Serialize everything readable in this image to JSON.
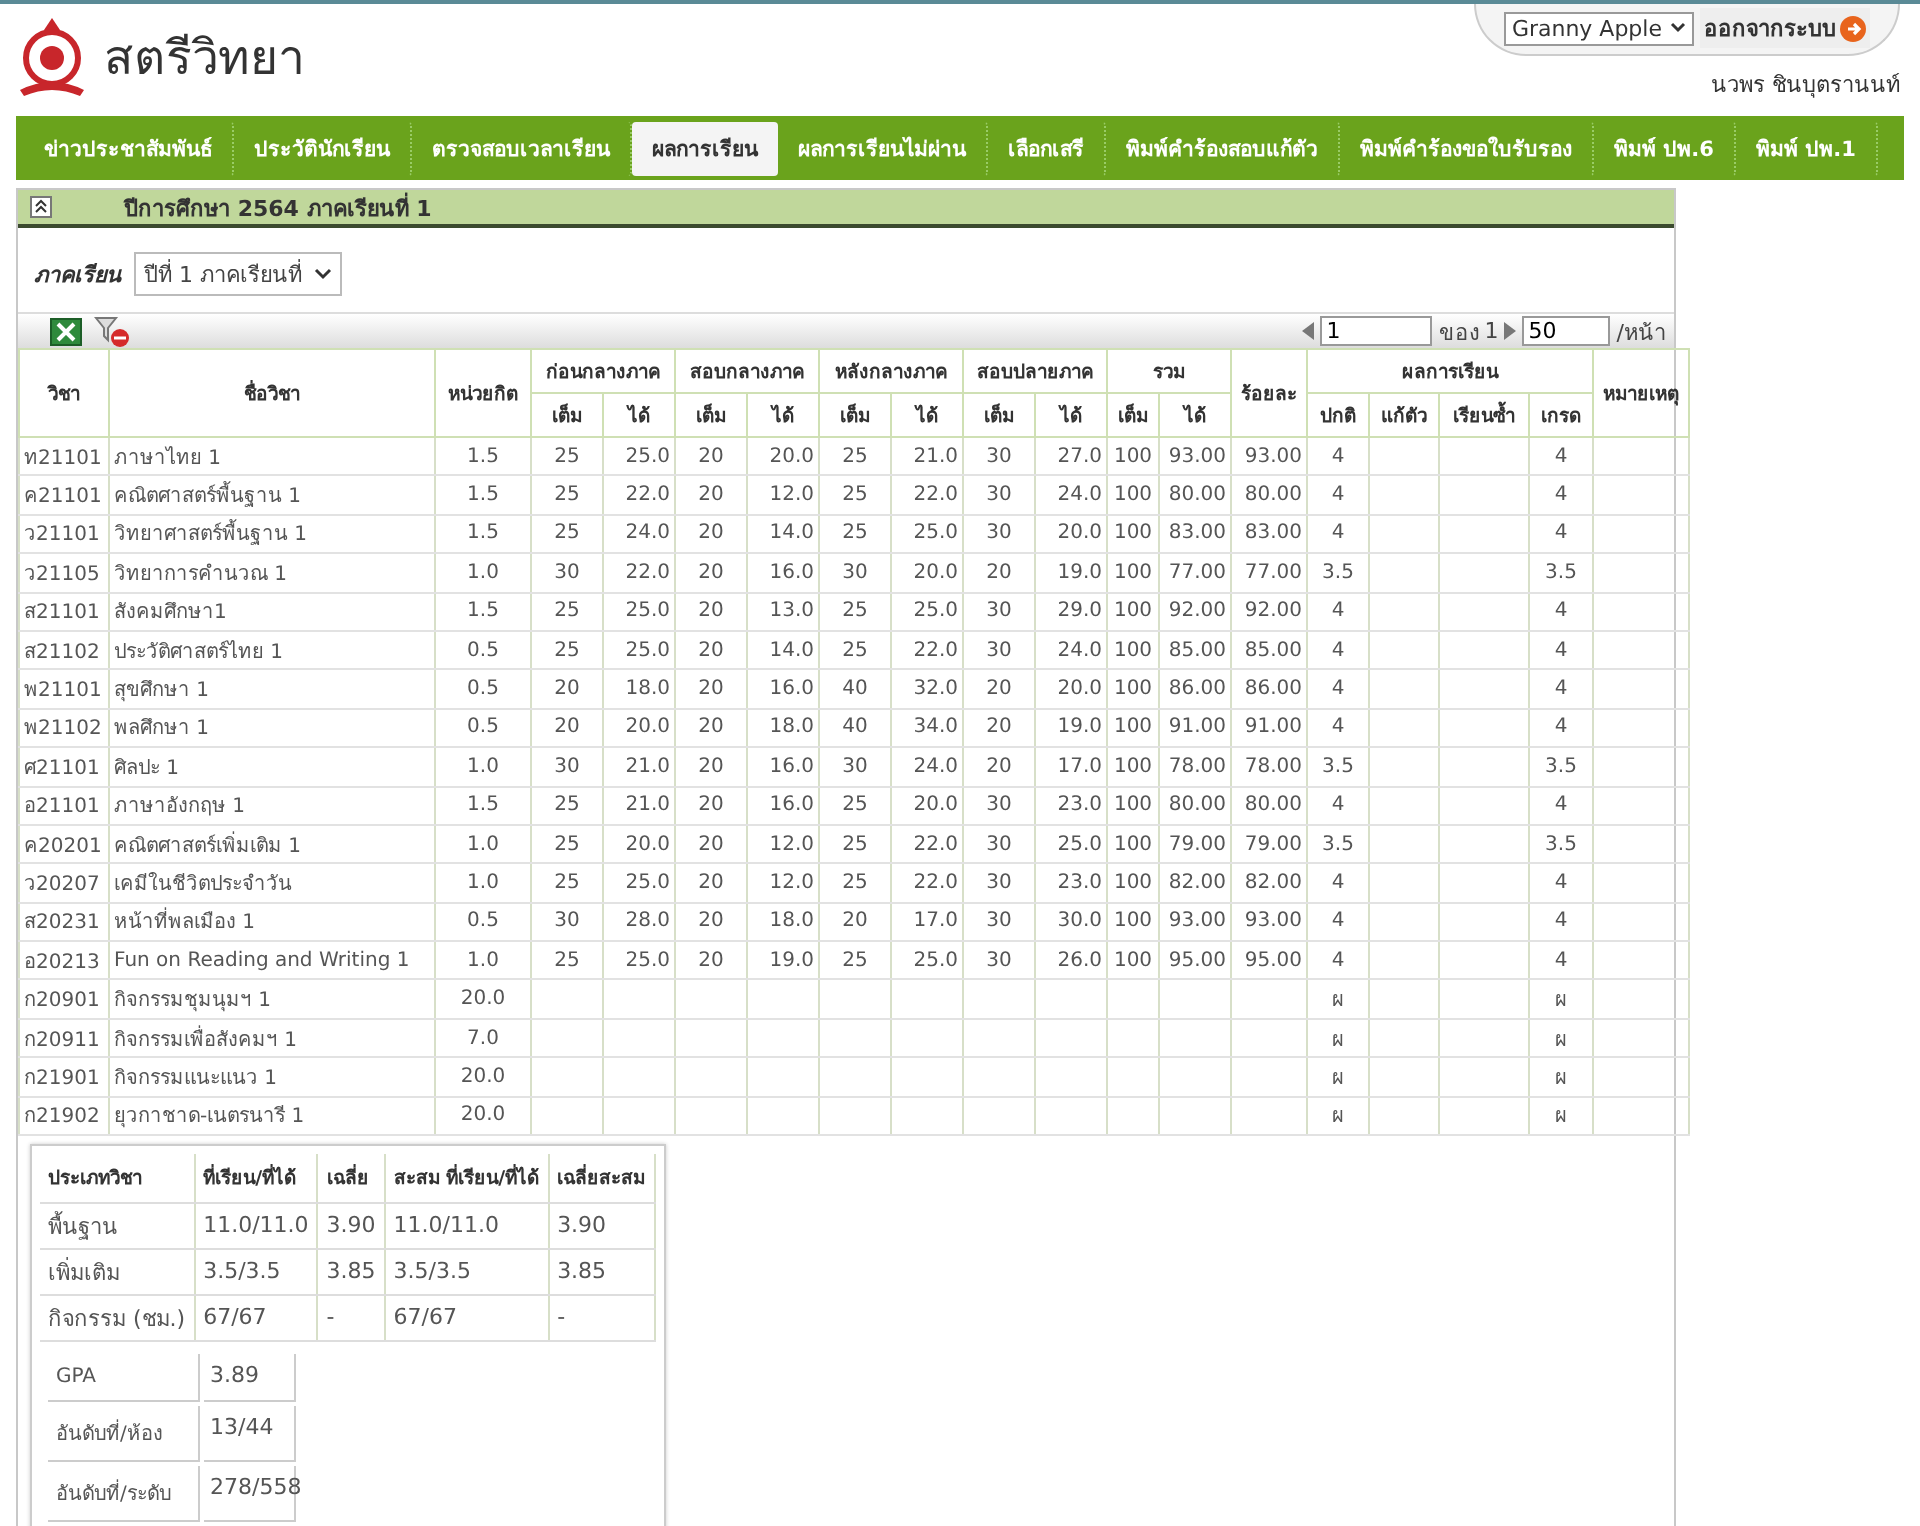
{
  "header": {
    "logo_text": "สตรีวิทยา",
    "theme_select": "Granny Apple",
    "logout": "ออกจากระบบ",
    "user": "นวพร  ชินบุตรานนท์"
  },
  "nav": [
    {
      "label": "ข่าวประชาสัมพันธ์",
      "selected": false
    },
    {
      "label": "ประวัตินักเรียน",
      "selected": false
    },
    {
      "label": "ตรวจสอบเวลาเรียน",
      "selected": false
    },
    {
      "label": "ผลการเรียน",
      "selected": true
    },
    {
      "label": "ผลการเรียนไม่ผ่าน",
      "selected": false
    },
    {
      "label": "เลือกเสรี",
      "selected": false
    },
    {
      "label": "พิมพ์คำร้องสอบแก้ตัว",
      "selected": false
    },
    {
      "label": "พิมพ์คำร้องขอใบรับรอง",
      "selected": false
    },
    {
      "label": "พิมพ์ ปพ.6",
      "selected": false
    },
    {
      "label": "พิมพ์ ปพ.1",
      "selected": false
    }
  ],
  "panel": {
    "title": "ปีการศึกษา  2564  ภาคเรียนที่  1",
    "expanded": true
  },
  "filter": {
    "label": "ภาคเรียน",
    "value": "ปีที่  1  ภาคเรียนที่"
  },
  "pager": {
    "page": "1",
    "of_label": "ของ",
    "total": "1",
    "per_page": "50",
    "per_page_label": "/หน้า"
  },
  "table": {
    "columns": [
      {
        "kind": "single",
        "label": "วิชา"
      },
      {
        "kind": "single",
        "label": "ชื่อวิชา"
      },
      {
        "kind": "single",
        "label": "หน่วยกิต"
      },
      {
        "kind": "group",
        "label": "ก่อนกลางภาค",
        "sub": [
          "เต็ม",
          "ได้"
        ]
      },
      {
        "kind": "group",
        "label": "สอบกลางภาค",
        "sub": [
          "เต็ม",
          "ได้"
        ]
      },
      {
        "kind": "group",
        "label": "หลังกลางภาค",
        "sub": [
          "เต็ม",
          "ได้"
        ]
      },
      {
        "kind": "group",
        "label": "สอบปลายภาค",
        "sub": [
          "เต็ม",
          "ได้"
        ]
      },
      {
        "kind": "group",
        "label": "รวม",
        "sub": [
          "เต็ม",
          "ได้"
        ]
      },
      {
        "kind": "single",
        "label": "ร้อยละ"
      },
      {
        "kind": "group",
        "label": "ผลการเรียน",
        "sub": [
          "ปกติ",
          "แก้ตัว",
          "เรียนซ้ำ",
          "เกรด"
        ]
      },
      {
        "kind": "single",
        "label": "หมายเหตุ"
      }
    ],
    "rows": [
      {
        "code": "ท21101",
        "name": "ภาษาไทย  1",
        "credit": "1.5",
        "scores": [
          "25",
          "25.0",
          "20",
          "20.0",
          "25",
          "21.0",
          "30",
          "27.0",
          "100",
          "93.00"
        ],
        "percent": "93.00",
        "normal": "4",
        "grade": "4"
      },
      {
        "code": "ค21101",
        "name": "คณิตศาสตร์พื้นฐาน  1",
        "credit": "1.5",
        "scores": [
          "25",
          "22.0",
          "20",
          "12.0",
          "25",
          "22.0",
          "30",
          "24.0",
          "100",
          "80.00"
        ],
        "percent": "80.00",
        "normal": "4",
        "grade": "4"
      },
      {
        "code": "ว21101",
        "name": "วิทยาศาสตร์พื้นฐาน  1",
        "credit": "1.5",
        "scores": [
          "25",
          "24.0",
          "20",
          "14.0",
          "25",
          "25.0",
          "30",
          "20.0",
          "100",
          "83.00"
        ],
        "percent": "83.00",
        "normal": "4",
        "grade": "4"
      },
      {
        "code": "ว21105",
        "name": "วิทยาการคำนวณ  1",
        "credit": "1.0",
        "scores": [
          "30",
          "22.0",
          "20",
          "16.0",
          "30",
          "20.0",
          "20",
          "19.0",
          "100",
          "77.00"
        ],
        "percent": "77.00",
        "normal": "3.5",
        "grade": "3.5"
      },
      {
        "code": "ส21101",
        "name": "สังคมศึกษา1",
        "credit": "1.5",
        "scores": [
          "25",
          "25.0",
          "20",
          "13.0",
          "25",
          "25.0",
          "30",
          "29.0",
          "100",
          "92.00"
        ],
        "percent": "92.00",
        "normal": "4",
        "grade": "4"
      },
      {
        "code": "ส21102",
        "name": "ประวัติศาสตร์ไทย  1",
        "credit": "0.5",
        "scores": [
          "25",
          "25.0",
          "20",
          "14.0",
          "25",
          "22.0",
          "30",
          "24.0",
          "100",
          "85.00"
        ],
        "percent": "85.00",
        "normal": "4",
        "grade": "4"
      },
      {
        "code": "พ21101",
        "name": "สุขศึกษา  1",
        "credit": "0.5",
        "scores": [
          "20",
          "18.0",
          "20",
          "16.0",
          "40",
          "32.0",
          "20",
          "20.0",
          "100",
          "86.00"
        ],
        "percent": "86.00",
        "normal": "4",
        "grade": "4"
      },
      {
        "code": "พ21102",
        "name": "พลศึกษา  1",
        "credit": "0.5",
        "scores": [
          "20",
          "20.0",
          "20",
          "18.0",
          "40",
          "34.0",
          "20",
          "19.0",
          "100",
          "91.00"
        ],
        "percent": "91.00",
        "normal": "4",
        "grade": "4"
      },
      {
        "code": "ศ21101",
        "name": "ศิลปะ  1",
        "credit": "1.0",
        "scores": [
          "30",
          "21.0",
          "20",
          "16.0",
          "30",
          "24.0",
          "20",
          "17.0",
          "100",
          "78.00"
        ],
        "percent": "78.00",
        "normal": "3.5",
        "grade": "3.5"
      },
      {
        "code": "อ21101",
        "name": "ภาษาอังกฤษ  1",
        "credit": "1.5",
        "scores": [
          "25",
          "21.0",
          "20",
          "16.0",
          "25",
          "20.0",
          "30",
          "23.0",
          "100",
          "80.00"
        ],
        "percent": "80.00",
        "normal": "4",
        "grade": "4"
      },
      {
        "code": "ค20201",
        "name": "คณิตศาสตร์เพิ่มเติม  1",
        "credit": "1.0",
        "scores": [
          "25",
          "20.0",
          "20",
          "12.0",
          "25",
          "22.0",
          "30",
          "25.0",
          "100",
          "79.00"
        ],
        "percent": "79.00",
        "normal": "3.5",
        "grade": "3.5"
      },
      {
        "code": "ว20207",
        "name": "เคมีในชีวิตประจำวัน",
        "credit": "1.0",
        "scores": [
          "25",
          "25.0",
          "20",
          "12.0",
          "25",
          "22.0",
          "30",
          "23.0",
          "100",
          "82.00"
        ],
        "percent": "82.00",
        "normal": "4",
        "grade": "4"
      },
      {
        "code": "ส20231",
        "name": "หน้าที่พลเมือง  1",
        "credit": "0.5",
        "scores": [
          "30",
          "28.0",
          "20",
          "18.0",
          "20",
          "17.0",
          "30",
          "30.0",
          "100",
          "93.00"
        ],
        "percent": "93.00",
        "normal": "4",
        "grade": "4"
      },
      {
        "code": "อ20213",
        "name": "Fun on Reading and Writing 1",
        "credit": "1.0",
        "scores": [
          "25",
          "25.0",
          "20",
          "19.0",
          "25",
          "25.0",
          "30",
          "26.0",
          "100",
          "95.00"
        ],
        "percent": "95.00",
        "normal": "4",
        "grade": "4"
      },
      {
        "code": "ก20901",
        "name": "กิจกรรมชุมนุมฯ  1",
        "credit": "20.0",
        "normal": "ผ",
        "grade": "ผ"
      },
      {
        "code": "ก20911",
        "name": "กิจกรรมเพื่อสังคมฯ  1",
        "credit": "7.0",
        "normal": "ผ",
        "grade": "ผ"
      },
      {
        "code": "ก21901",
        "name": "กิจกรรมแนะแนว  1",
        "credit": "20.0",
        "normal": "ผ",
        "grade": "ผ"
      },
      {
        "code": "ก21902",
        "name": "ยุวกาชาด-เนตรนารี  1",
        "credit": "20.0",
        "normal": "ผ",
        "grade": "ผ"
      }
    ]
  },
  "summary": {
    "columns": [
      "ประเภทวิชา",
      "ที่เรียน/ที่ได้",
      "เฉลี่ย",
      "สะสม  ที่เรียน/ที่ได้",
      "เฉลี่ยสะสม"
    ],
    "rows": [
      [
        "พื้นฐาน",
        "11.0/11.0",
        "3.90",
        "11.0/11.0",
        "3.90"
      ],
      [
        "เพิ่มเติม",
        "3.5/3.5",
        "3.85",
        "3.5/3.5",
        "3.85"
      ],
      [
        "กิจกรรม  (ชม.)",
        "67/67",
        "-",
        "67/67",
        "-"
      ]
    ],
    "stats": [
      {
        "label": "GPA",
        "value": "3.89"
      },
      {
        "label": "อันดับที่/ห้อง",
        "value": "13/44"
      },
      {
        "label": "อันดับที่/ระดับ",
        "value": "278/558"
      }
    ]
  }
}
